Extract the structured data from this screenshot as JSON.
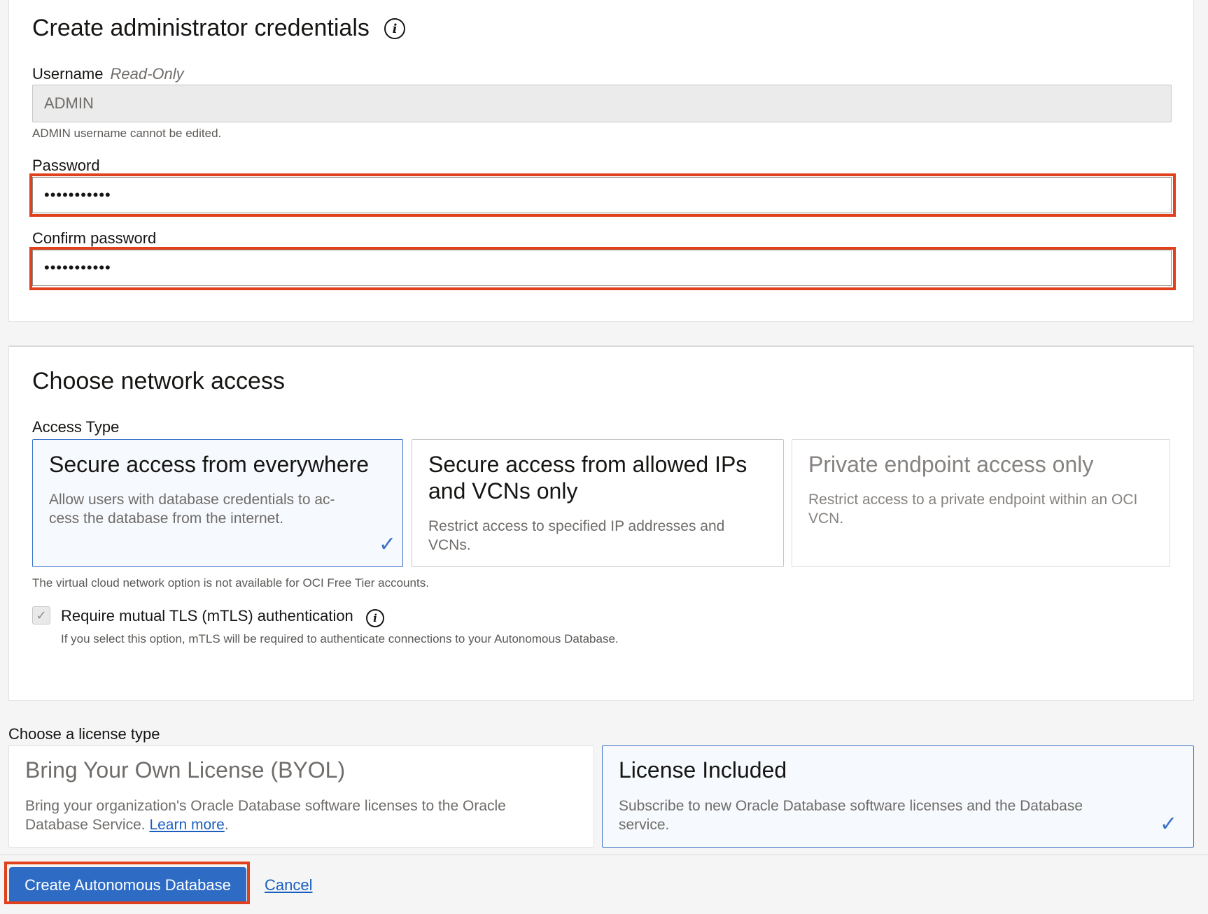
{
  "admin_section": {
    "title": "Create administrator credentials",
    "username_label": "Username",
    "username_readonly_tag": "Read-Only",
    "username_value": "ADMIN",
    "username_help": "ADMIN username cannot be edited.",
    "password_label": "Password",
    "password_value": "•••••••••••",
    "confirm_label": "Confirm password",
    "confirm_value": "•••••••••••",
    "info_icon": "info-icon"
  },
  "network_section": {
    "title": "Choose network access",
    "access_type_label": "Access Type",
    "options": [
      {
        "title": "Secure access from everywhere",
        "description": "Allow users with database credentials to ac- cess the database from the internet.",
        "selected": true
      },
      {
        "title": "Secure access from allowed IPs and VCNs only",
        "description": "Restrict access to specified IP addresses and VCNs.",
        "selected": false
      },
      {
        "title": "Private endpoint access only",
        "description": "Restrict access to a private endpoint within an OCI VCN.",
        "selected": false,
        "disabled": true
      }
    ],
    "vcn_note": "The virtual cloud network option is not available for OCI Free Tier accounts.",
    "mtls_label": "Require mutual TLS (mTLS) authentication",
    "mtls_checked": true,
    "mtls_help": "If you select this option, mTLS will be required to authenticate connections to your Autonomous Database."
  },
  "license_section": {
    "title": "Choose a license type",
    "options": [
      {
        "title": "Bring Your Own License (BYOL)",
        "description": "Bring your organization's Oracle Database software licenses to the Oracle Database Service.",
        "link": "Learn more",
        "selected": false
      },
      {
        "title": "License Included",
        "description": "Subscribe to new Oracle Database software licenses and the Database service.",
        "selected": true
      }
    ]
  },
  "footer": {
    "create_label": "Create Autonomous Database",
    "cancel_label": "Cancel"
  },
  "colors": {
    "highlight": "#e0401c",
    "primary": "#2d6bc4",
    "selected_border": "#3c73c7"
  },
  "icons": {
    "check": "checkmark-icon",
    "info": "info-icon"
  }
}
